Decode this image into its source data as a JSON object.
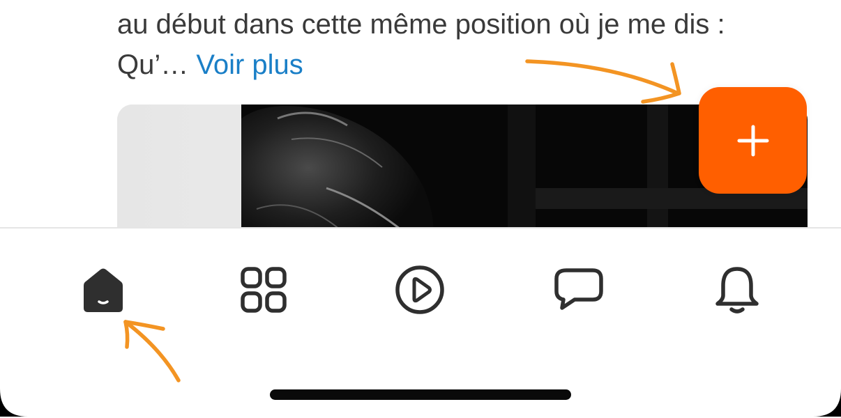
{
  "post": {
    "line1": "au début dans cette même position où je me dis :",
    "line2_prefix": "Qu’… ",
    "see_more": "Voir plus"
  },
  "fab": {
    "icon": "plus-icon",
    "color": "#ff5f00"
  },
  "tab_bar": {
    "items": [
      {
        "id": "home",
        "icon": "home-icon",
        "active": true
      },
      {
        "id": "discover",
        "icon": "grid-icon",
        "active": false
      },
      {
        "id": "videos",
        "icon": "play-icon",
        "active": false
      },
      {
        "id": "messages",
        "icon": "chat-bubble-icon",
        "active": false
      },
      {
        "id": "notifications",
        "icon": "bell-icon",
        "active": false
      }
    ]
  },
  "colors": {
    "accent": "#ff5f00",
    "link": "#1a7fc7",
    "text": "#3a3a3a",
    "icon": "#2f2f2f",
    "annotation_arrow": "#f39423"
  }
}
